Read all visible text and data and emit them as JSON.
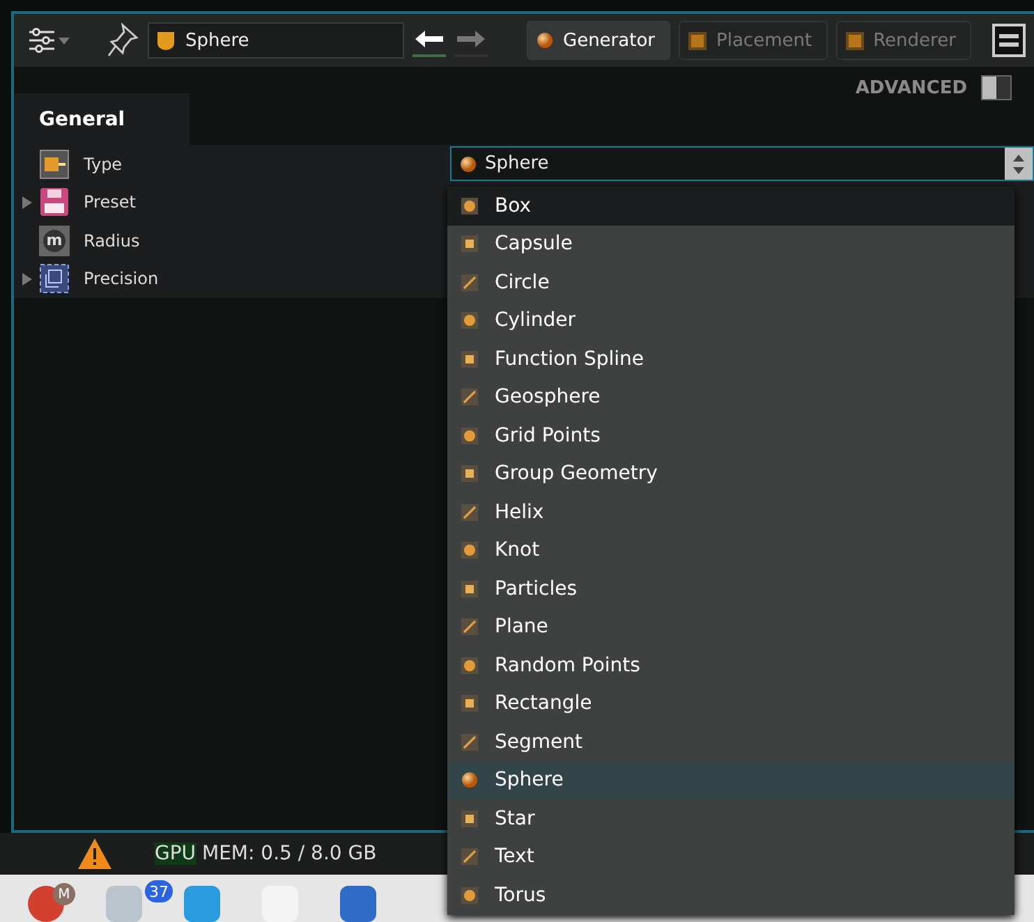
{
  "toolbar": {
    "object_name": "Sphere",
    "nav": [
      {
        "kind": "back",
        "selected": true
      },
      {
        "kind": "forward",
        "selected": false
      }
    ],
    "tabs": [
      {
        "label": "Generator",
        "selected": true
      },
      {
        "label": "Placement",
        "selected": false
      },
      {
        "label": "Renderer",
        "selected": false
      }
    ]
  },
  "panel": {
    "section_tab": "General",
    "advanced": {
      "label": "ADVANCED",
      "on": false
    },
    "properties": [
      {
        "label": "Type",
        "expandable": false
      },
      {
        "label": "Preset",
        "expandable": true
      },
      {
        "label": "Radius",
        "expandable": false,
        "icon_glyph": "m"
      },
      {
        "label": "Precision",
        "expandable": true
      }
    ],
    "type_value": "Sphere"
  },
  "dropdown": {
    "items": [
      {
        "label": "Box",
        "selected": false,
        "highlighted": true
      },
      {
        "label": "Capsule",
        "selected": false,
        "highlighted": false
      },
      {
        "label": "Circle",
        "selected": false,
        "highlighted": false
      },
      {
        "label": "Cylinder",
        "selected": false,
        "highlighted": false
      },
      {
        "label": "Function Spline",
        "selected": false,
        "highlighted": false
      },
      {
        "label": "Geosphere",
        "selected": false,
        "highlighted": false
      },
      {
        "label": "Grid Points",
        "selected": false,
        "highlighted": false
      },
      {
        "label": "Group Geometry",
        "selected": false,
        "highlighted": false
      },
      {
        "label": "Helix",
        "selected": false,
        "highlighted": false
      },
      {
        "label": "Knot",
        "selected": false,
        "highlighted": false
      },
      {
        "label": "Particles",
        "selected": false,
        "highlighted": false
      },
      {
        "label": "Plane",
        "selected": false,
        "highlighted": false
      },
      {
        "label": "Random Points",
        "selected": false,
        "highlighted": false
      },
      {
        "label": "Rectangle",
        "selected": false,
        "highlighted": false
      },
      {
        "label": "Segment",
        "selected": false,
        "highlighted": false
      },
      {
        "label": "Sphere",
        "selected": true,
        "highlighted": false
      },
      {
        "label": "Star",
        "selected": false,
        "highlighted": false
      },
      {
        "label": "Text",
        "selected": false,
        "highlighted": false
      },
      {
        "label": "Torus",
        "selected": false,
        "highlighted": false
      }
    ]
  },
  "status_bar": {
    "gpu_label": "GPU",
    "gpu_text": " MEM: 0.5 / 8.0 GB"
  },
  "dock": {
    "avatar": "M",
    "badge": "37"
  }
}
